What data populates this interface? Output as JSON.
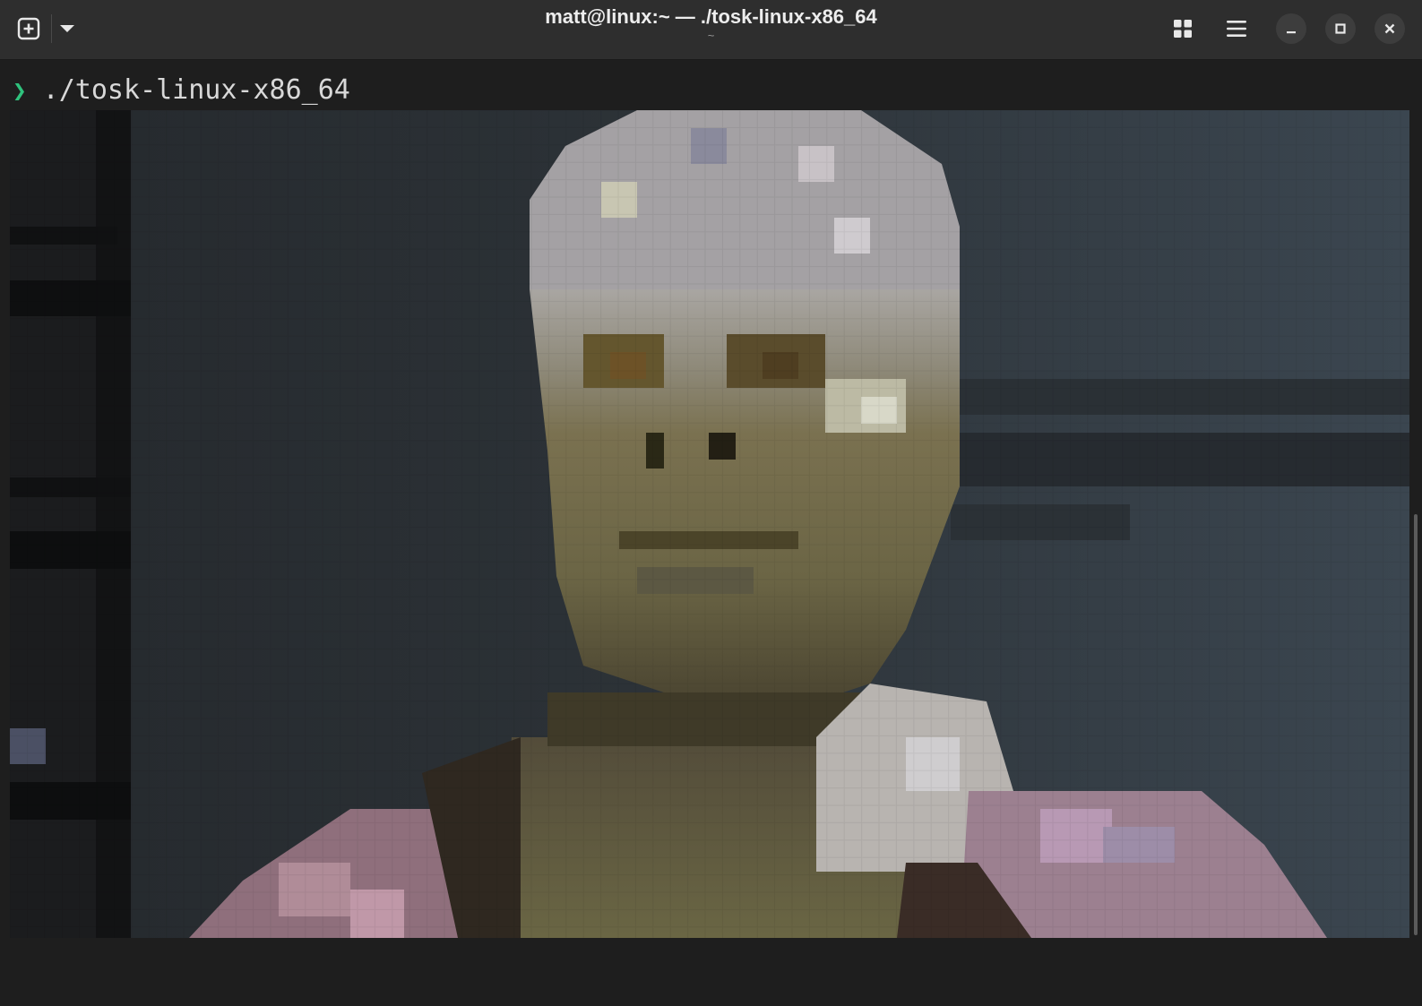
{
  "window": {
    "title": "matt@linux:~ — ./tosk-linux-x86_64",
    "subtitle": "~"
  },
  "header": {
    "buttons": [
      {
        "name": "new-tab-button",
        "icon": "plus-square-icon"
      },
      {
        "name": "tab-menu-button",
        "icon": "chevron-down-icon"
      },
      {
        "name": "tab-overview-button",
        "icon": "grid-icon"
      },
      {
        "name": "main-menu-button",
        "icon": "hamburger-icon"
      },
      {
        "name": "minimize-button",
        "icon": "minimize-icon"
      },
      {
        "name": "maximize-button",
        "icon": "maximize-icon"
      },
      {
        "name": "close-button",
        "icon": "close-icon"
      }
    ]
  },
  "terminal": {
    "prompt_symbol": "❯",
    "command": "./tosk-linux-x86_64"
  },
  "colors": {
    "prompt_accent": "#2fc27d",
    "background": "#1e1e1e",
    "headerbar": "#2e2e2e",
    "image_backdrop": "#2d3338"
  }
}
